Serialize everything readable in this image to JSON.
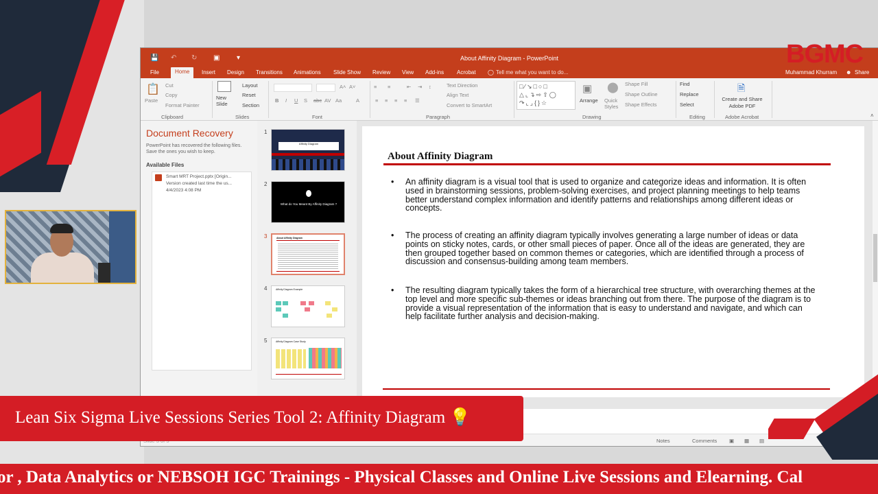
{
  "window": {
    "title": "About Affinity Diagram - PowerPoint",
    "user": "Muhammad Khurram",
    "share": "Share"
  },
  "menu": {
    "items": [
      "File",
      "Home",
      "Insert",
      "Design",
      "Transitions",
      "Animations",
      "Slide Show",
      "Review",
      "View",
      "Add-ins",
      "Acrobat"
    ],
    "tell_me": "Tell me what you want to do..."
  },
  "ribbon": {
    "clipboard": {
      "paste": "Paste",
      "cut": "Cut",
      "copy": "Copy",
      "format_painter": "Format Painter",
      "label": "Clipboard"
    },
    "slides": {
      "new_slide": "New Slide",
      "layout": "Layout",
      "reset": "Reset",
      "section": "Section",
      "label": "Slides"
    },
    "font": {
      "label": "Font"
    },
    "paragraph": {
      "text_direction": "Text Direction",
      "align_text": "Align Text",
      "convert_smartart": "Convert to SmartArt",
      "label": "Paragraph"
    },
    "drawing": {
      "arrange": "Arrange",
      "quick_styles": "Quick Styles",
      "shape_fill": "Shape Fill",
      "shape_outline": "Shape Outline",
      "shape_effects": "Shape Effects",
      "label": "Drawing"
    },
    "editing": {
      "find": "Find",
      "replace": "Replace",
      "select": "Select",
      "label": "Editing"
    },
    "acrobat": {
      "create_share": "Create and Share Adobe PDF",
      "label": "Adobe Acrobat"
    }
  },
  "recovery": {
    "title": "Document Recovery",
    "description": "PowerPoint has recovered the following files. Save the ones you wish to keep.",
    "available_files": "Available Files",
    "file_name": "Smart MRT Project.pptx [Origin...",
    "file_note": "Version created last time the us...",
    "file_date": "4/4/2023 4:08 PM"
  },
  "thumbnails": {
    "numbers": [
      "1",
      "2",
      "3",
      "4",
      "5"
    ],
    "slide1_title": "Affinity Diagram",
    "slide2_title": "What do You Meant By Affinity Diagram ?",
    "slide3_title": "About Affinity Diagram",
    "slide4_title": "Affinity Diagram Example",
    "slide5_title": "Affinity Diagram Case Study"
  },
  "slide": {
    "title": "About Affinity Diagram",
    "bullets": [
      "An affinity diagram is a visual tool that is used to organize and categorize ideas and information. It is often used in brainstorming sessions, problem-solving exercises, and project planning meetings to help teams better understand complex information and identify patterns and relationships among different ideas or concepts.",
      "The process of creating an affinity diagram typically involves generating a large number of ideas or data points on sticky notes, cards, or other small pieces of paper. Once all of the ideas are generated, they are then grouped together based on common themes or categories, which are identified through a process of discussion and consensus-building among team members.",
      "The resulting diagram typically takes the form of a hierarchical tree structure, with overarching themes at the top level and more specific sub-themes or ideas branching out from there. The purpose of the diagram is to provide a visual representation of the information that is easy to understand and navigate, and which can help facilitate further analysis and decision-making."
    ]
  },
  "status": {
    "slide_info": "Slide 3 of 5",
    "notes": "Notes",
    "comments": "Comments"
  },
  "overlay": {
    "logo": "BGMC",
    "banner": "Lean Six Sigma Live Sessions Series Tool 2: Affinity Diagram",
    "banner_emoji": "💡",
    "ticker": "or , Data Analytics or NEBSOH IGC Trainings - Physical Classes and Online Live Sessions and Elearning. Cal"
  },
  "colors": {
    "ppt_accent": "#c43e1c",
    "brand_red": "#d41d25",
    "slide_rule": "#c00000"
  }
}
